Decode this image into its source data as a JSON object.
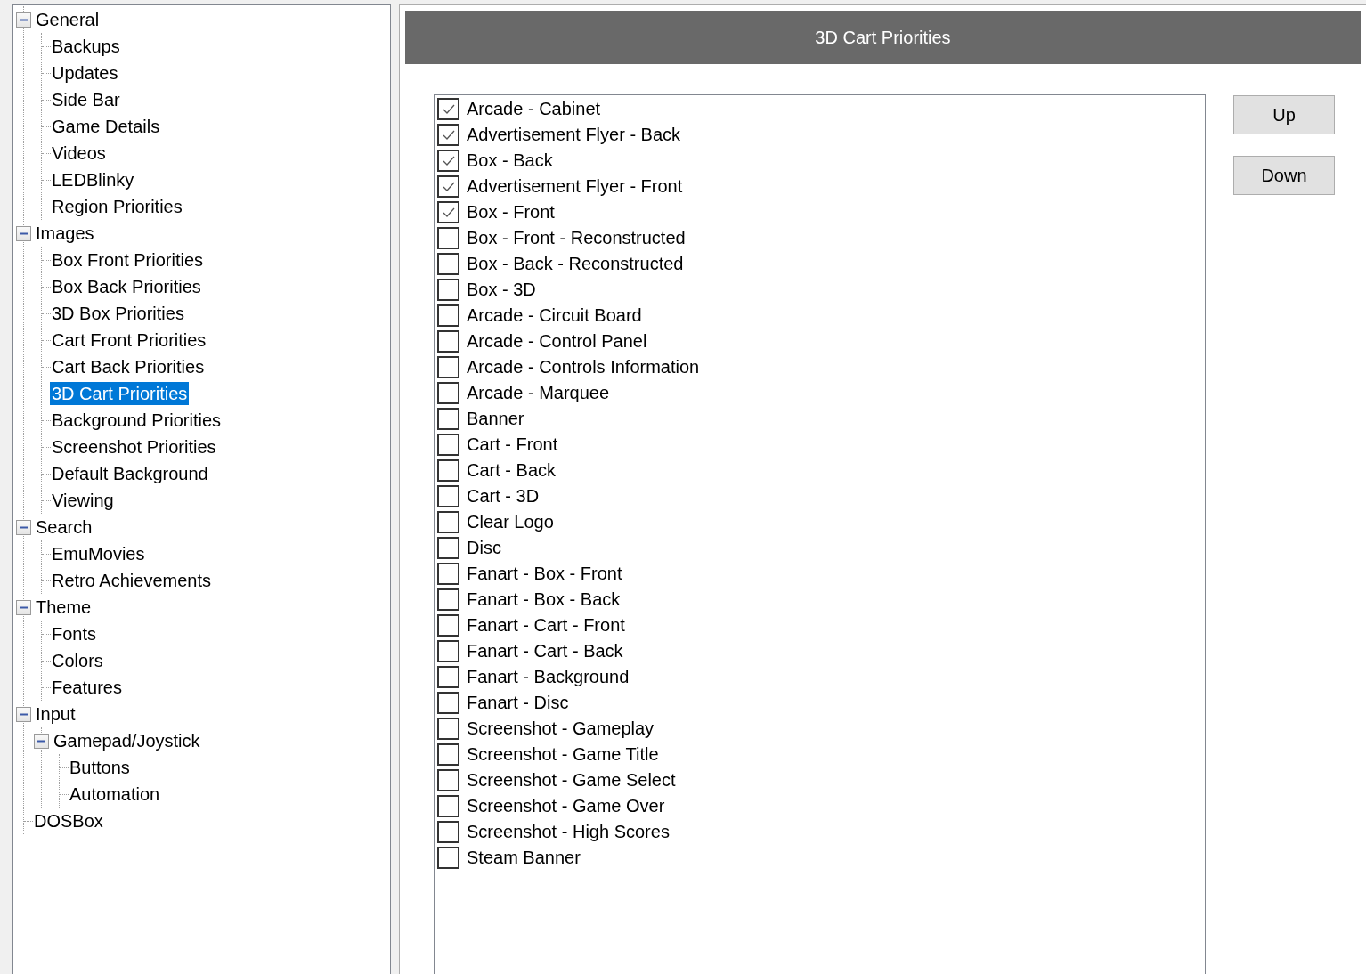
{
  "tree": [
    {
      "label": "General",
      "expanded": true,
      "selected": false,
      "children": [
        {
          "label": "Backups",
          "selected": false
        },
        {
          "label": "Updates",
          "selected": false
        },
        {
          "label": "Side Bar",
          "selected": false
        },
        {
          "label": "Game Details",
          "selected": false
        },
        {
          "label": "Videos",
          "selected": false
        },
        {
          "label": "LEDBlinky",
          "selected": false
        },
        {
          "label": "Region Priorities",
          "selected": false
        }
      ]
    },
    {
      "label": "Images",
      "expanded": true,
      "selected": false,
      "children": [
        {
          "label": "Box Front Priorities",
          "selected": false
        },
        {
          "label": "Box Back Priorities",
          "selected": false
        },
        {
          "label": "3D Box Priorities",
          "selected": false
        },
        {
          "label": "Cart Front Priorities",
          "selected": false
        },
        {
          "label": "Cart Back Priorities",
          "selected": false
        },
        {
          "label": "3D Cart Priorities",
          "selected": true
        },
        {
          "label": "Background Priorities",
          "selected": false
        },
        {
          "label": "Screenshot Priorities",
          "selected": false
        },
        {
          "label": "Default Background",
          "selected": false
        },
        {
          "label": "Viewing",
          "selected": false
        }
      ]
    },
    {
      "label": "Search",
      "expanded": true,
      "selected": false,
      "children": [
        {
          "label": "EmuMovies",
          "selected": false
        },
        {
          "label": "Retro Achievements",
          "selected": false
        }
      ]
    },
    {
      "label": "Theme",
      "expanded": true,
      "selected": false,
      "children": [
        {
          "label": "Fonts",
          "selected": false
        },
        {
          "label": "Colors",
          "selected": false
        },
        {
          "label": "Features",
          "selected": false
        }
      ]
    },
    {
      "label": "Input",
      "expanded": true,
      "selected": false,
      "children": [
        {
          "label": "Gamepad/Joystick",
          "expanded": true,
          "selected": false,
          "children": [
            {
              "label": "Buttons",
              "selected": false
            },
            {
              "label": "Automation",
              "selected": false
            }
          ]
        }
      ]
    },
    {
      "label": "DOSBox",
      "selected": false
    }
  ],
  "panel": {
    "title": "3D Cart Priorities",
    "items": [
      {
        "label": "Arcade - Cabinet",
        "checked": true
      },
      {
        "label": "Advertisement Flyer - Back",
        "checked": true
      },
      {
        "label": "Box - Back",
        "checked": true
      },
      {
        "label": "Advertisement Flyer - Front",
        "checked": true
      },
      {
        "label": "Box - Front",
        "checked": true
      },
      {
        "label": "Box - Front - Reconstructed",
        "checked": false
      },
      {
        "label": "Box - Back - Reconstructed",
        "checked": false
      },
      {
        "label": "Box - 3D",
        "checked": false
      },
      {
        "label": "Arcade - Circuit Board",
        "checked": false
      },
      {
        "label": "Arcade - Control Panel",
        "checked": false
      },
      {
        "label": "Arcade - Controls Information",
        "checked": false
      },
      {
        "label": "Arcade - Marquee",
        "checked": false
      },
      {
        "label": "Banner",
        "checked": false
      },
      {
        "label": "Cart - Front",
        "checked": false
      },
      {
        "label": "Cart - Back",
        "checked": false
      },
      {
        "label": "Cart - 3D",
        "checked": false
      },
      {
        "label": "Clear Logo",
        "checked": false
      },
      {
        "label": "Disc",
        "checked": false
      },
      {
        "label": "Fanart - Box - Front",
        "checked": false
      },
      {
        "label": "Fanart - Box - Back",
        "checked": false
      },
      {
        "label": "Fanart - Cart - Front",
        "checked": false
      },
      {
        "label": "Fanart - Cart - Back",
        "checked": false
      },
      {
        "label": "Fanart - Background",
        "checked": false
      },
      {
        "label": "Fanart - Disc",
        "checked": false
      },
      {
        "label": "Screenshot - Gameplay",
        "checked": false
      },
      {
        "label": "Screenshot - Game Title",
        "checked": false
      },
      {
        "label": "Screenshot - Game Select",
        "checked": false
      },
      {
        "label": "Screenshot - Game Over",
        "checked": false
      },
      {
        "label": "Screenshot - High Scores",
        "checked": false
      },
      {
        "label": "Steam Banner",
        "checked": false
      }
    ],
    "buttons": [
      "Up",
      "Down"
    ]
  }
}
